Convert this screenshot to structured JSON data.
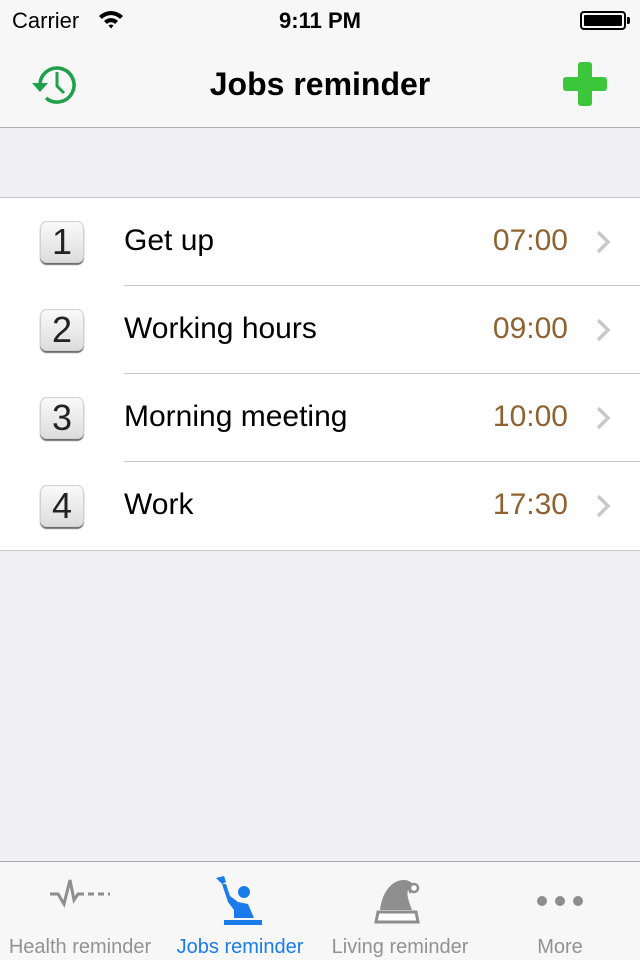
{
  "status_bar": {
    "carrier": "Carrier",
    "time": "9:11 PM"
  },
  "nav": {
    "title": "Jobs reminder",
    "left_icon": "history-clock-icon",
    "right_icon": "plus-icon",
    "colors": {
      "history": "#1fa04a",
      "add": "#3cc63c"
    }
  },
  "reminders": [
    {
      "number": "1",
      "label": "Get up",
      "time": "07:00"
    },
    {
      "number": "2",
      "label": "Working hours",
      "time": "09:00"
    },
    {
      "number": "3",
      "label": "Morning meeting",
      "time": "10:00"
    },
    {
      "number": "4",
      "label": "Work",
      "time": "17:30"
    }
  ],
  "tabbar": {
    "tabs": [
      {
        "label": "Health reminder",
        "icon": "heartbeat-icon",
        "active": false
      },
      {
        "label": "Jobs reminder",
        "icon": "worker-icon",
        "active": true
      },
      {
        "label": "Living reminder",
        "icon": "santa-hat-icon",
        "active": false
      },
      {
        "label": "More",
        "icon": "more-dots-icon",
        "active": false
      }
    ],
    "active_color": "#1a7bea",
    "inactive_color": "#929292"
  },
  "colors": {
    "time_text": "#8f6331"
  }
}
